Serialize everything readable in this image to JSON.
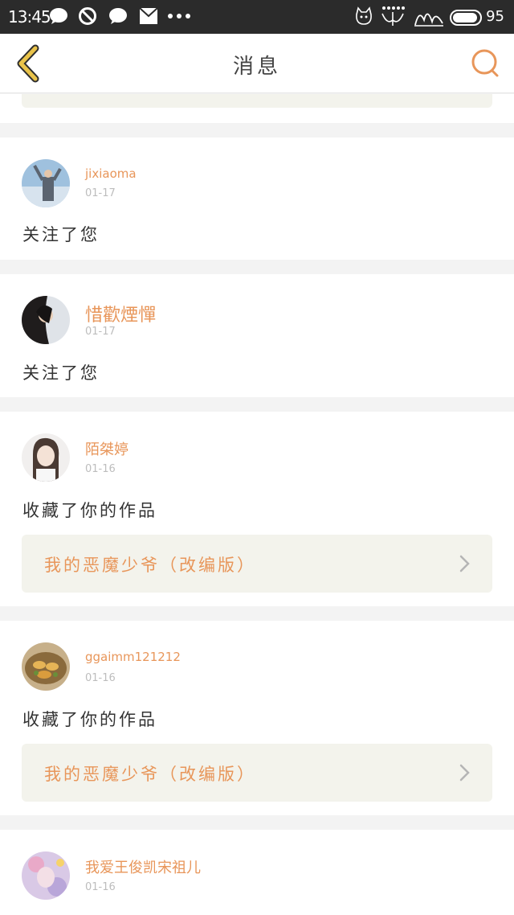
{
  "status_bar": {
    "time": "13:45",
    "battery": "95",
    "icons": [
      "chat-bubble-icon",
      "blocked-icon",
      "chat-bubble-icon",
      "mail-icon",
      "more-dots-icon",
      "cat-icon",
      "signal-icon",
      "wifi-icon"
    ]
  },
  "header": {
    "title": "消息",
    "back_icon": "chevron-left-icon",
    "search_icon": "search-icon"
  },
  "colors": {
    "accent": "#e8965a",
    "back_yellow": "#e9c34a",
    "card_bg": "#ffffff",
    "page_bg": "#f3f3f3",
    "work_bg": "#f3f3ec"
  },
  "messages": [
    {
      "username": "jixiaoma",
      "date": "01-17",
      "action": "关注了您"
    },
    {
      "username": "惜歡煙憚",
      "date": "01-17",
      "action": "关注了您"
    },
    {
      "username": "陌桀婷",
      "date": "01-16",
      "action": "收藏了你的作品",
      "work": "我的恶魔少爷（改编版）"
    },
    {
      "username": "ggaimm121212",
      "date": "01-16",
      "action": "收藏了你的作品",
      "work": "我的恶魔少爷（改编版）"
    },
    {
      "username": "我爱王俊凯宋祖儿",
      "date": "01-16"
    }
  ]
}
